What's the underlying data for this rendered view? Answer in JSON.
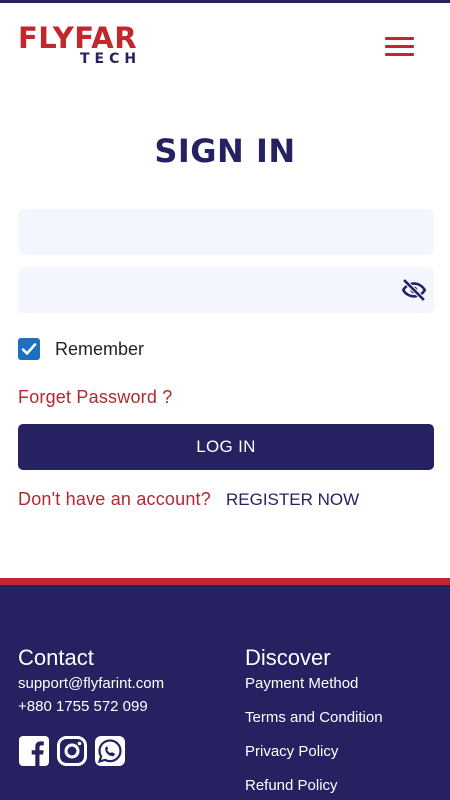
{
  "brand": {
    "logo_main": "FLYFAR",
    "logo_sub": "TECH",
    "primary_color": "#262262",
    "accent_color": "#c1272d"
  },
  "header": {
    "menu_icon": "hamburger-menu-icon"
  },
  "signin": {
    "title": "SIGN IN",
    "email_value": "",
    "password_value": "",
    "password_toggle_icon": "eye-slash-icon",
    "remember_label": "Remember",
    "remember_checked": true,
    "forget_label": "Forget Password ?",
    "login_label": "LOG IN",
    "no_account_text": "Don't have an account?",
    "register_label": "REGISTER NOW"
  },
  "footer": {
    "contact": {
      "heading": "Contact",
      "email": "support@flyfarint.com",
      "phone": "+880 1755 572 099"
    },
    "discover": {
      "heading": "Discover",
      "links": [
        "Payment Method",
        "Terms and Condition",
        "Privacy Policy",
        "Refund Policy"
      ]
    },
    "socials": [
      "facebook-icon",
      "instagram-icon",
      "whatsapp-icon"
    ]
  }
}
